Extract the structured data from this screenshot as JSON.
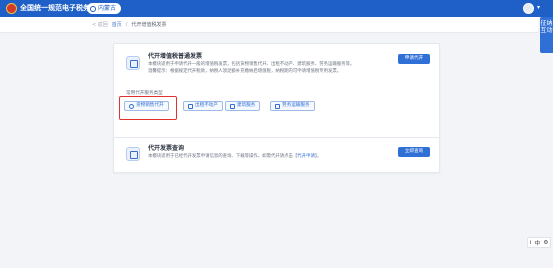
{
  "header": {
    "site_title": "全国统一规范电子税务局",
    "region": "内蒙古",
    "colors": {
      "bar": "#1e5fc8",
      "accent": "#2f6fd6"
    }
  },
  "side_tab": {
    "line1": "征纳",
    "line2": "互动"
  },
  "breadcrumb": {
    "back": "< 返回",
    "home": "首页",
    "sep": "/",
    "current": "代开增值税发票"
  },
  "card_vat": {
    "icon": "invoice-icon",
    "title": "代开增值税普通发票",
    "desc1": "本模块适用于申请代开一般的增值税发票，包括货物销售代开、出租不动产、建筑服务、劳务运输服务等。",
    "desc2": "温馨提示：根据规定代开税款，纳税人须足额补充缴纳后增值税，纳税期内可申请增值税专用发票。",
    "action": "申请代开",
    "section_label": "常用代开服务类型",
    "types": [
      {
        "label": "货物销售代开",
        "icon": "goods-icon"
      },
      {
        "label": "出租不动产",
        "icon": "house-icon"
      },
      {
        "label": "建筑服务",
        "icon": "building-icon"
      },
      {
        "label": "劳务运输服务",
        "icon": "transport-icon"
      }
    ]
  },
  "card_query": {
    "icon": "query-icon",
    "title": "代开发票查询",
    "desc_prefix": "本模块适用于已经代开发票申请信息的查询、下载等操作，如需代开请点击【",
    "desc_link": "代开申请",
    "desc_suffix": "】。",
    "action": "立即查询"
  },
  "float_tools": {
    "t1": "i",
    "t2": "中",
    "t3": "⚙"
  }
}
